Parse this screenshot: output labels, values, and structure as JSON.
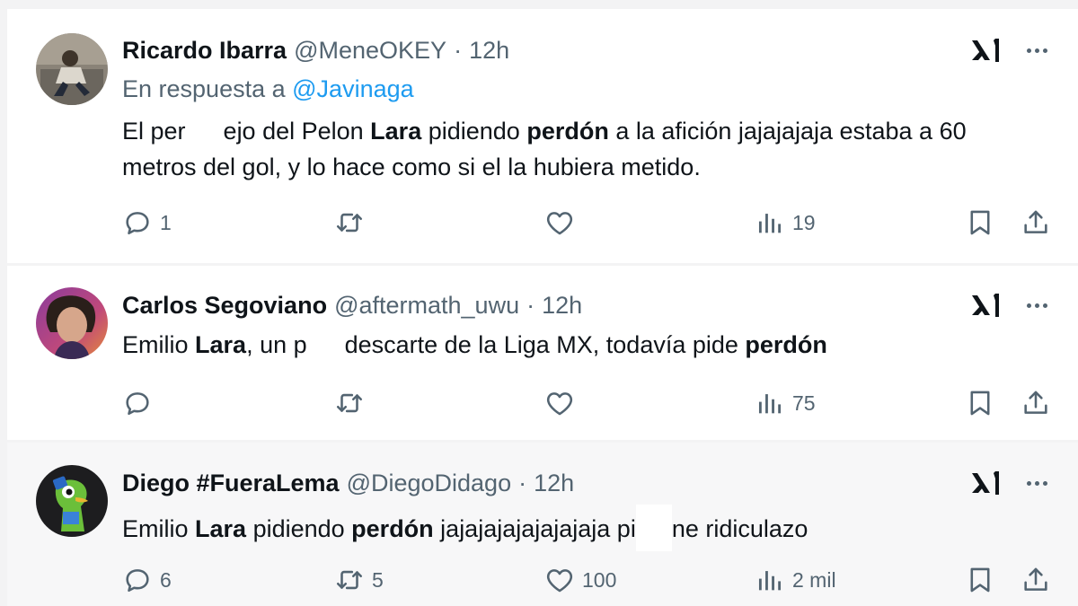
{
  "tweets": [
    {
      "name": "Ricardo Ibarra",
      "handle": "@MeneOKEY",
      "dot": "·",
      "time": "12h",
      "reply_prefix": "En respuesta a",
      "reply_handle": "@Javinaga",
      "text": {
        "p1": "El per",
        "p2": "ejo del Pelon ",
        "b1": "Lara",
        "p3": " pidiendo ",
        "b2": "perdón",
        "p4": " a la afición jajajajaja estaba a 60 metros del gol, y lo hace como si el la hubiera metido."
      },
      "replies": "1",
      "retweets": "",
      "likes": "",
      "views": "19"
    },
    {
      "name": "Carlos Segoviano",
      "handle": "@aftermath_uwu",
      "dot": "·",
      "time": "12h",
      "text": {
        "p1": "Emilio ",
        "b1": "Lara",
        "p2": ", un p",
        "p3": "descarte de la Liga MX, todavía pide ",
        "b2": "perdón"
      },
      "replies": "",
      "retweets": "",
      "likes": "",
      "views": "75"
    },
    {
      "name": "Diego #FueraLema",
      "handle": "@DiegoDidago",
      "dot": "·",
      "time": "12h",
      "text": {
        "p1": "Emilio ",
        "b1": "Lara",
        "p2": " pidiendo ",
        "b2": "perdón",
        "p3": " jajajajajajajajaja pi",
        "p4": "ne ridiculazo"
      },
      "replies": "6",
      "retweets": "5",
      "likes": "100",
      "views": "2 mil"
    }
  ],
  "icons": {
    "reply": "speech-bubble-icon",
    "retweet": "retweet-arrows-icon",
    "like": "heart-icon",
    "views": "bar-chart-icon",
    "bookmark": "bookmark-icon",
    "share": "share-upload-icon",
    "grok": "grok-logo-icon",
    "more": "more-dots-icon"
  },
  "colors": {
    "text": "#0f1419",
    "secondary": "#536471",
    "link": "#1d9bf0",
    "background": "#ffffff",
    "separator": "#f3f3f4"
  }
}
